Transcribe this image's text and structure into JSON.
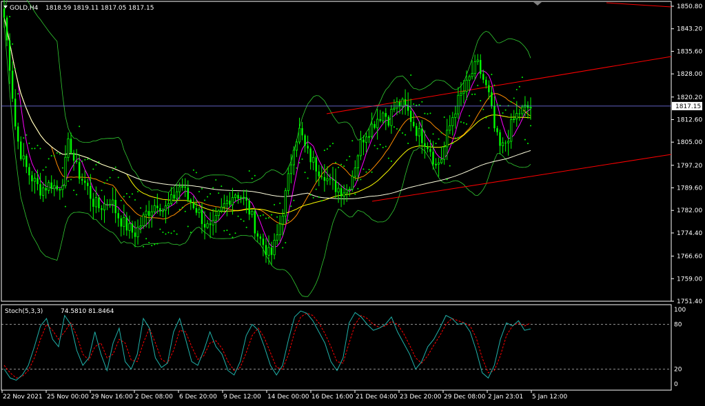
{
  "symbol_header": {
    "symbol": "GOLD,H4",
    "ohlc": "1818.59 1819.11 1817.05 1817.15"
  },
  "indicator_header": {
    "name": "Stoch(5,3,3)",
    "values": "74.5810 81.8464"
  },
  "colors": {
    "background": "#000000",
    "frame": "#ffffff",
    "bull_bar": "#00ff00",
    "bear_bar": "#00ff00",
    "bid_line": "#8080ff",
    "ma_fast": "#ff00ff",
    "ma_mid": "#ff8c00",
    "ma_slow": "#ffff00",
    "ma_long": "#ffffe0",
    "bollinger": "#32cd32",
    "sar": "#00ff00",
    "channel": "#ff0000",
    "stoch_main": "#20b2aa",
    "stoch_signal": "#ff0000",
    "stoch_level": "#c0c0c0"
  },
  "chart_data": [
    {
      "type": "candlestick",
      "title": "GOLD,H4",
      "price_axis_ticks": [
        "1850.80",
        "1843.20",
        "1835.60",
        "1828.00",
        "1820.20",
        "1812.60",
        "1805.00",
        "1797.20",
        "1789.60",
        "1782.00",
        "1774.40",
        "1766.60",
        "1759.00",
        "1751.40"
      ],
      "ylim": [
        1751.4,
        1850.8
      ],
      "current_price_label": "1817.15",
      "time_axis_labels": [
        "22 Nov 2021",
        "25 Nov 00:00",
        "29 Nov 16:00",
        "2 Dec 08:00",
        "6 Dec 20:00",
        "9 Dec 12:00",
        "14 Dec 00:00",
        "16 Dec 16:00",
        "21 Dec 04:00",
        "23 Dec 20:00",
        "29 Dec 08:00",
        "2 Jan 23:01",
        "5 Jan 12:00"
      ],
      "close_path": [
        1847,
        1830,
        1808,
        1800,
        1795,
        1792,
        1789,
        1790,
        1791,
        1789,
        1793,
        1806,
        1797,
        1793,
        1790,
        1785,
        1783,
        1784,
        1786,
        1781,
        1778,
        1776,
        1774,
        1777,
        1781,
        1783,
        1785,
        1782,
        1784,
        1788,
        1791,
        1786,
        1784,
        1781,
        1777,
        1775,
        1779,
        1783,
        1786,
        1788,
        1787,
        1784,
        1779,
        1773,
        1770,
        1766,
        1772,
        1781,
        1792,
        1805,
        1809,
        1802,
        1799,
        1796,
        1795,
        1791,
        1790,
        1789,
        1789,
        1795,
        1803,
        1808,
        1810,
        1813,
        1815,
        1813,
        1817,
        1818,
        1816,
        1812,
        1808,
        1806,
        1803,
        1797,
        1800,
        1808,
        1815,
        1820,
        1823,
        1828,
        1831,
        1826,
        1820,
        1808,
        1802,
        1806,
        1812,
        1815,
        1816,
        1817
      ],
      "indicators": {
        "moving_averages": [
          "fast (magenta)",
          "mid (orange)",
          "slow (yellow)",
          "long (white)"
        ],
        "bollinger_bands": true,
        "parabolic_sar": true,
        "trend_channel": true
      }
    },
    {
      "type": "line",
      "title": "Stoch(5,3,3)",
      "ylim": [
        0,
        100
      ],
      "axis_ticks": [
        "100",
        "80",
        "20",
        "0"
      ],
      "levels": [
        80,
        20
      ],
      "series": [
        {
          "name": "",
          "values": [
            20,
            8,
            5,
            12,
            25,
            50,
            78,
            88,
            60,
            50,
            92,
            80,
            45,
            25,
            35,
            70,
            40,
            18,
            55,
            75,
            30,
            20,
            40,
            88,
            75,
            35,
            22,
            28,
            70,
            88,
            60,
            30,
            25,
            45,
            70,
            50,
            40,
            18,
            12,
            30,
            65,
            80,
            72,
            50,
            25,
            12,
            25,
            60,
            90,
            98,
            95,
            85,
            70,
            55,
            30,
            18,
            35,
            82,
            96,
            90,
            80,
            72,
            75,
            80,
            90,
            70,
            55,
            40,
            20,
            30,
            50,
            60,
            75,
            92,
            88,
            80,
            82,
            70,
            45,
            15,
            8,
            25,
            60,
            82,
            78,
            85,
            72,
            74
          ]
        },
        {
          "name": "",
          "values": [
            25,
            15,
            8,
            10,
            18,
            35,
            60,
            80,
            72,
            60,
            70,
            82,
            65,
            40,
            32,
            50,
            55,
            35,
            40,
            60,
            55,
            32,
            30,
            55,
            75,
            55,
            33,
            28,
            45,
            72,
            70,
            50,
            33,
            38,
            55,
            58,
            48,
            30,
            18,
            22,
            42,
            65,
            75,
            62,
            42,
            22,
            20,
            40,
            70,
            90,
            95,
            92,
            82,
            68,
            50,
            30,
            28,
            55,
            80,
            92,
            88,
            80,
            76,
            78,
            84,
            80,
            68,
            52,
            35,
            28,
            38,
            52,
            65,
            80,
            88,
            85,
            82,
            78,
            62,
            35,
            15,
            18,
            38,
            65,
            78,
            82,
            78,
            81.8
          ]
        }
      ]
    }
  ]
}
